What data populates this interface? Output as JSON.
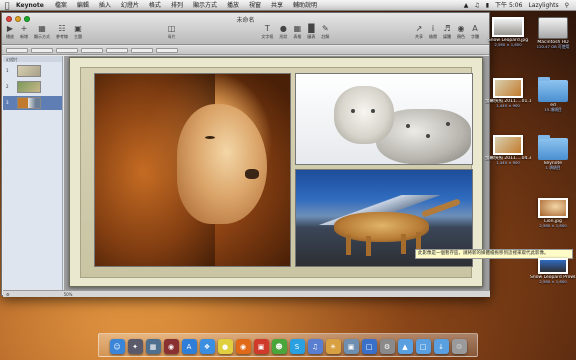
{
  "menubar": {
    "app_name": "Keynote",
    "items": [
      "檔案",
      "編輯",
      "插入",
      "幻燈片",
      "格式",
      "排列",
      "顯示方式",
      "播放",
      "視窗",
      "共享",
      "輔助說明"
    ],
    "clock": "下午 5:06",
    "user": "Lazylights"
  },
  "window": {
    "title": "未命名",
    "toolbar": [
      {
        "icon": "play-icon",
        "label": "播放"
      },
      {
        "icon": "new-slide-icon",
        "label": "新增"
      },
      {
        "icon": "view-icon",
        "label": "顯示方式"
      },
      {
        "icon": "guides-icon",
        "label": "參考線"
      },
      {
        "icon": "themes-icon",
        "label": "主題"
      },
      {
        "icon": "masters-icon",
        "label": "母片"
      },
      {
        "icon": "textbox-icon",
        "label": "文字框"
      },
      {
        "icon": "shapes-icon",
        "label": "形狀"
      },
      {
        "icon": "table-icon",
        "label": "表格"
      },
      {
        "icon": "chart-icon",
        "label": "圖表"
      },
      {
        "icon": "comment-icon",
        "label": "註解"
      },
      {
        "icon": "share-icon",
        "label": "共享"
      },
      {
        "icon": "inspector-icon",
        "label": "檢閱"
      },
      {
        "icon": "media-icon",
        "label": "媒體"
      },
      {
        "icon": "colors-icon",
        "label": "顏色"
      },
      {
        "icon": "fonts-icon",
        "label": "字體"
      }
    ],
    "navigator_header": "幻燈片",
    "slides": [
      {
        "number": "1",
        "selected": false
      },
      {
        "number": "2",
        "selected": false
      },
      {
        "number": "3",
        "selected": true
      }
    ],
    "zoom": "50%",
    "tooltip": "此影像是一個暫存區，請將新的媒體檔拖移到這裡來取代此影像。"
  },
  "desktop": {
    "items": [
      {
        "name": "Snow Leopard.jpg",
        "info": "2,560 × 1,600",
        "kind": "image"
      },
      {
        "name": "Macintosh HD",
        "info": "120.47 GB 可使用",
        "kind": "drive"
      },
      {
        "name": "螢幕快照 2011....01.17",
        "info": "1,440 × 900",
        "kind": "image"
      },
      {
        "name": "ed",
        "info": "15 項項目",
        "kind": "folder"
      },
      {
        "name": "螢幕快照 2011....04.39",
        "info": "1,440 × 900",
        "kind": "image"
      },
      {
        "name": "keynote",
        "info": "1 項項目",
        "kind": "folder"
      },
      {
        "name": "Lion.jpg",
        "info": "2,560 × 1,600",
        "kind": "image"
      },
      {
        "name": "Snow Leopard Prowl.jpg",
        "info": "2,560 × 1,600",
        "kind": "image"
      }
    ]
  },
  "dock": [
    {
      "icon": "finder-icon",
      "color": "#3b86d8"
    },
    {
      "icon": "launchpad-icon",
      "color": "#5a5a6a"
    },
    {
      "icon": "mission-control-icon",
      "color": "#4f6f8f"
    },
    {
      "icon": "photo-booth-icon",
      "color": "#8a3030"
    },
    {
      "icon": "app-store-icon",
      "color": "#2f7fd8"
    },
    {
      "icon": "safari-icon",
      "color": "#3c8fe0"
    },
    {
      "icon": "chrome-icon",
      "color": "#e0d040"
    },
    {
      "icon": "firefox-icon",
      "color": "#e06a1a"
    },
    {
      "icon": "calendar-icon",
      "color": "#d03a2a"
    },
    {
      "icon": "messenger-icon",
      "color": "#4aa63a"
    },
    {
      "icon": "skype-icon",
      "color": "#2aa0e0"
    },
    {
      "icon": "itunes-icon",
      "color": "#5a7fd0"
    },
    {
      "icon": "iphoto-icon",
      "color": "#d8a040"
    },
    {
      "icon": "preview-icon",
      "color": "#6e8fb0"
    },
    {
      "icon": "keynote-icon",
      "color": "#3a70c8"
    },
    {
      "icon": "system-preferences-icon",
      "color": "#8a8a8a"
    },
    {
      "icon": "applications-folder-icon",
      "color": "#5aa0e0"
    },
    {
      "icon": "documents-folder-icon",
      "color": "#5aa0e0"
    },
    {
      "icon": "downloads-folder-icon",
      "color": "#5aa0e0"
    },
    {
      "icon": "trash-icon",
      "color": "#9a9a9a"
    }
  ]
}
